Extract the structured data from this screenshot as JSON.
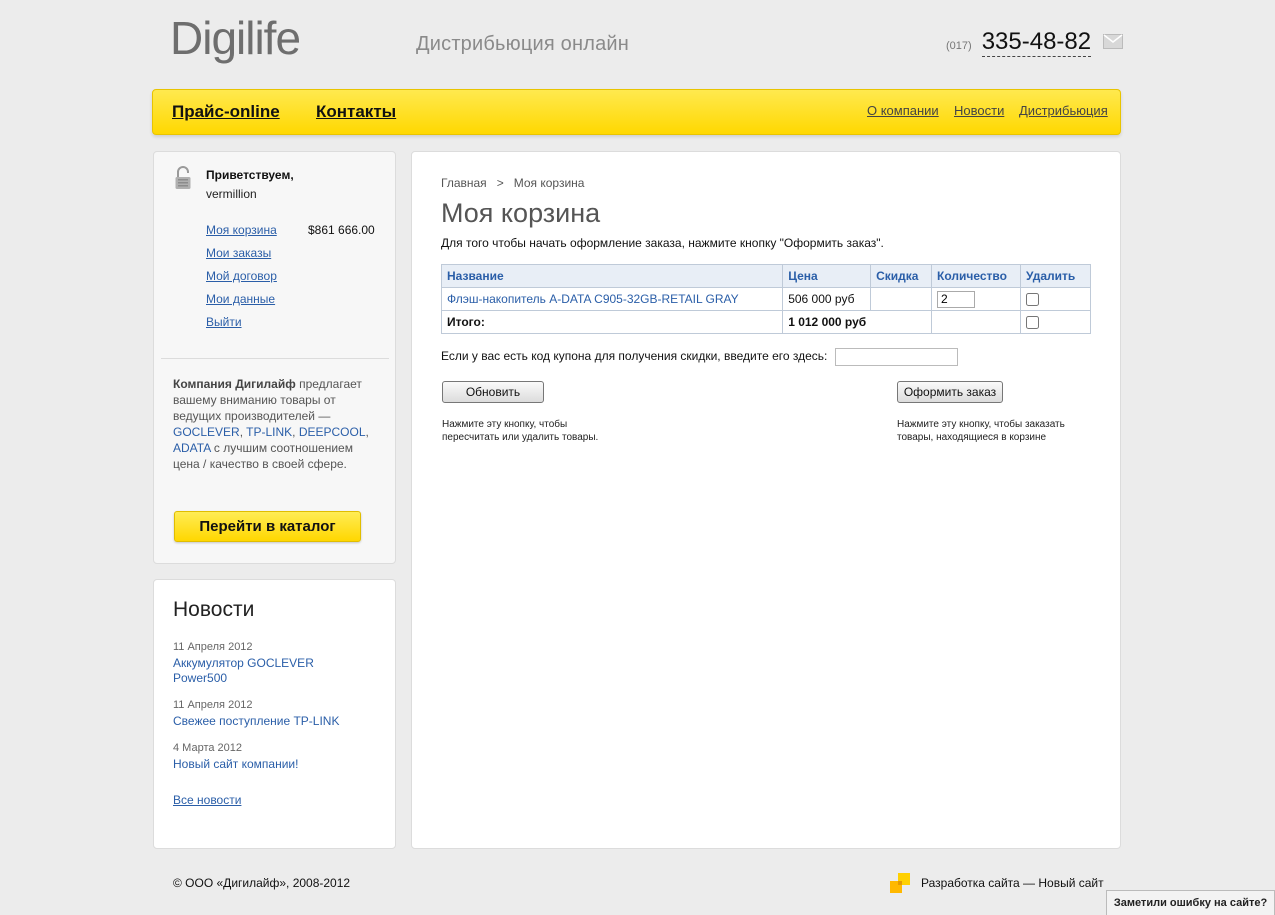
{
  "header": {
    "logo_text": "Digilife",
    "tagline": "Дистрибьюция онлайн",
    "phone_code": "(017)",
    "phone_number": "335-48-82"
  },
  "nav": {
    "main": [
      "Прайс-online",
      "Контакты"
    ],
    "secondary": [
      "О компании",
      "Новости",
      "Дистрибьюция"
    ]
  },
  "user_panel": {
    "greeting": "Приветствуем,",
    "username": "vermillion",
    "cart_total": "$861 666.00",
    "links": [
      "Моя корзина",
      "Мои заказы",
      "Мой договор",
      "Мои данные",
      "Выйти"
    ],
    "promo": {
      "company": "Компания Дигилайф",
      "text1": " предлагает вашему вниманию товары от ведущих производителей — ",
      "brands": [
        "GOCLEVER",
        "TP-LINK",
        "DEEPCOOL",
        "ADATA"
      ],
      "text2": " с лучшим соотношением цена / качество в своей сфере."
    },
    "catalog_button": "Перейти в каталог"
  },
  "news": {
    "title": "Новости",
    "items": [
      {
        "date": "11 Апреля 2012",
        "title": "Аккумулятор GOCLEVER Power500"
      },
      {
        "date": "11 Апреля 2012",
        "title": "Свежее поступление TP-LINK"
      },
      {
        "date": "4 Марта 2012",
        "title": "Новый сайт компании!"
      }
    ],
    "all_news": "Все новости"
  },
  "main": {
    "breadcrumb": {
      "home": "Главная",
      "separator": ">",
      "current": "Моя корзина"
    },
    "title": "Моя корзина",
    "intro": "Для того чтобы начать оформление заказа, нажмите кнопку \"Оформить заказ\".",
    "table": {
      "headers": [
        "Название",
        "Цена",
        "Скидка",
        "Количество",
        "Удалить"
      ],
      "rows": [
        {
          "name": "Флэш-накопитель A-DATA C905-32GB-RETAIL GRAY",
          "price": "506 000 руб",
          "discount": "",
          "quantity": "2"
        }
      ],
      "total_label": "Итого:",
      "total_value": "1 012 000 руб"
    },
    "coupon_label": "Если у вас есть код купона для получения скидки, введите его здесь:",
    "update_button": "Обновить",
    "order_button": "Оформить заказ",
    "update_hint_1": "Нажмите эту кнопку, чтобы",
    "update_hint_2": "пересчитать или удалить товары.",
    "order_hint_1": "Нажмите эту кнопку, чтобы заказать",
    "order_hint_2": "товары, находящиеся в корзине"
  },
  "footer": {
    "copyright": "© ООО «Дигилайф», 2008-2012",
    "developer": "Разработка сайта — Новый сайт",
    "error_tab": "Заметили ошибку на сайте?"
  },
  "colors": {
    "accent_yellow": "#ffd800",
    "link_blue": "#2a5ea8",
    "logo_gray": "#6e6e6e",
    "logo_yellow": "#ffcc00"
  }
}
